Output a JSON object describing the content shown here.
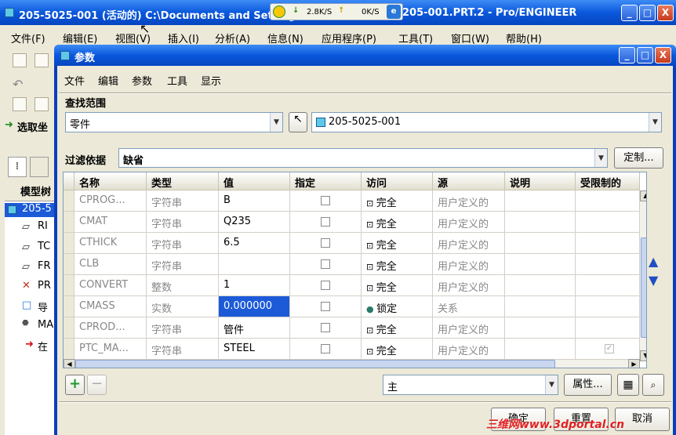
{
  "main_window": {
    "title": "205-5025-001 (活动的) C:\\Documents and Settings",
    "title_suffix": "205-001.PRT.2 - Pro/ENGINEER",
    "controls": {
      "minimize": "_",
      "maximize": "□",
      "close": "X"
    }
  },
  "net_meter": {
    "down": "2.8K/S",
    "up": "0K/S"
  },
  "main_menu": [
    "文件(F)",
    "编辑(E)",
    "视图(V)",
    "插入(I)",
    "分析(A)",
    "信息(N)",
    "应用程序(P)",
    "工具(T)",
    "窗口(W)",
    "帮助(H)"
  ],
  "left_panel": {
    "select_label": "选取坐",
    "tab_label": "模型树",
    "tree": [
      "205-5",
      "RI",
      "TC",
      "FR",
      "PR",
      "导",
      "MA",
      "在"
    ]
  },
  "dialog": {
    "title": "参数",
    "controls": {
      "minimize": "_",
      "maximize": "□",
      "close": "X"
    },
    "menu": [
      "文件",
      "编辑",
      "参数",
      "工具",
      "显示"
    ],
    "search_group_label": "查找范围",
    "scope_value": "零件",
    "object_value": "205-5025-001",
    "filter_label": "过滤依据",
    "filter_value": "缺省",
    "customize_button": "定制...",
    "columns": [
      "名称",
      "类型",
      "值",
      "指定",
      "访问",
      "源",
      "说明",
      "受限制的"
    ],
    "rows": [
      {
        "name": "CPROG...",
        "type": "字符串",
        "value": "B",
        "access": "完全",
        "source": "用户定义的",
        "note": "",
        "restricted": false
      },
      {
        "name": "CMAT",
        "type": "字符串",
        "value": "Q235",
        "access": "完全",
        "source": "用户定义的",
        "note": "",
        "restricted": false
      },
      {
        "name": "CTHICK",
        "type": "字符串",
        "value": "6.5",
        "access": "完全",
        "source": "用户定义的",
        "note": "",
        "restricted": false
      },
      {
        "name": "CLB",
        "type": "字符串",
        "value": "",
        "access": "完全",
        "source": "用户定义的",
        "note": "",
        "restricted": false
      },
      {
        "name": "CONVERT",
        "type": "整数",
        "value": "1",
        "access": "完全",
        "source": "用户定义的",
        "note": "",
        "restricted": false
      },
      {
        "name": "CMASS",
        "type": "实数",
        "value": "0.000000",
        "access": "锁定",
        "source": "关系",
        "note": "",
        "restricted": false
      },
      {
        "name": "CPROD...",
        "type": "字符串",
        "value": "管件",
        "access": "完全",
        "source": "用户定义的",
        "note": "",
        "restricted": false
      },
      {
        "name": "PTC_MA...",
        "type": "字符串",
        "value": "STEEL",
        "access": "完全",
        "source": "用户定义的",
        "note": "",
        "restricted": true
      }
    ],
    "add_symbol": "+",
    "remove_symbol": "−",
    "main_dropdown": "主",
    "properties_button": "属性...",
    "ok_button": "确定",
    "reset_button": "重置",
    "cancel_button": "取消"
  },
  "watermark": "三维网www.3dportal.cn",
  "colors": {
    "titlebar": "#0a58dc",
    "selection": "#1c5ad8",
    "add": "#1e9a2a",
    "arrows": "#1f4fc4"
  },
  "icons": [
    "app-icon",
    "cursor-icon",
    "part-icon",
    "lock-icon",
    "arrow-up-icon",
    "arrow-down-icon",
    "table-icon",
    "binoculars-icon"
  ]
}
